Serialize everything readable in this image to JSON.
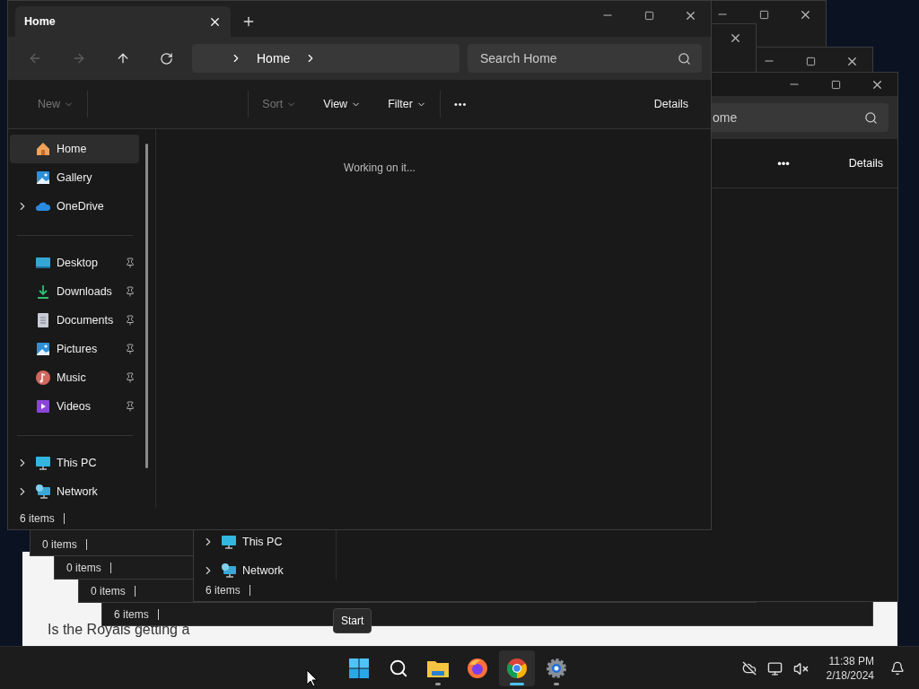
{
  "desktop": {
    "web_page_text": "Is the Royals getting a"
  },
  "background_windows": [
    {
      "status": "0 items"
    },
    {
      "status": "0 items"
    },
    {
      "status": "0 items"
    },
    {
      "status": "6 items"
    }
  ],
  "rear_window": {
    "search": "ome",
    "more": "•••",
    "details": "Details",
    "sidebar": [
      {
        "label": "This PC",
        "kind": "pc",
        "expandable": true
      },
      {
        "label": "Network",
        "kind": "network",
        "expandable": true
      }
    ],
    "status": "6 items"
  },
  "window": {
    "tabs": [
      {
        "label": "Home",
        "selected": true
      }
    ],
    "nav": [
      {
        "kind": "back",
        "disabled": true
      },
      {
        "kind": "forward",
        "disabled": true
      },
      {
        "kind": "up",
        "disabled": false
      },
      {
        "kind": "refresh",
        "disabled": false
      }
    ],
    "address": {
      "segments": [
        "Home"
      ]
    },
    "search": {
      "placeholder": "Search Home"
    },
    "commands": [
      {
        "kind": "new",
        "label": "New",
        "disabled": true
      },
      {
        "kind": "sort",
        "label": "Sort",
        "disabled": true
      },
      {
        "kind": "view",
        "label": "View",
        "disabled": false
      },
      {
        "kind": "filter",
        "label": "Filter",
        "disabled": false
      },
      {
        "kind": "more",
        "label": "•••",
        "disabled": false
      },
      {
        "kind": "details",
        "label": "Details",
        "disabled": false
      }
    ],
    "sidebar": {
      "groups": [
        {
          "items": [
            {
              "label": "Home",
              "kind": "home",
              "expandable": false,
              "pinned": false,
              "selected": true
            },
            {
              "label": "Gallery",
              "kind": "gallery",
              "expandable": false,
              "pinned": false,
              "selected": false
            },
            {
              "label": "OneDrive",
              "kind": "cloud",
              "expandable": true,
              "pinned": false,
              "selected": false
            }
          ]
        },
        {
          "items": [
            {
              "label": "Desktop",
              "kind": "desktop",
              "expandable": false,
              "pinned": true,
              "selected": false
            },
            {
              "label": "Downloads",
              "kind": "downloads",
              "expandable": false,
              "pinned": true,
              "selected": false
            },
            {
              "label": "Documents",
              "kind": "documents",
              "expandable": false,
              "pinned": true,
              "selected": false
            },
            {
              "label": "Pictures",
              "kind": "pictures",
              "expandable": false,
              "pinned": true,
              "selected": false
            },
            {
              "label": "Music",
              "kind": "music",
              "expandable": false,
              "pinned": true,
              "selected": false
            },
            {
              "label": "Videos",
              "kind": "videos",
              "expandable": false,
              "pinned": true,
              "selected": false
            }
          ]
        },
        {
          "items": [
            {
              "label": "This PC",
              "kind": "pc",
              "expandable": true,
              "pinned": false,
              "selected": false
            },
            {
              "label": "Network",
              "kind": "network",
              "expandable": true,
              "pinned": false,
              "selected": false
            }
          ]
        }
      ]
    },
    "content_message": "Working on it...",
    "status": "6 items"
  },
  "tooltip": "Start",
  "taskbar": {
    "apps": [
      {
        "kind": "start",
        "running": false,
        "selected": false
      },
      {
        "kind": "search",
        "running": false,
        "selected": false
      },
      {
        "kind": "explorer",
        "running": true,
        "selected": false
      },
      {
        "kind": "firefox",
        "running": false,
        "selected": false
      },
      {
        "kind": "chrome",
        "running": true,
        "selected": true
      },
      {
        "kind": "settings",
        "running": true,
        "selected": false
      }
    ],
    "time": "11:38 PM",
    "date": "2/18/2024"
  }
}
